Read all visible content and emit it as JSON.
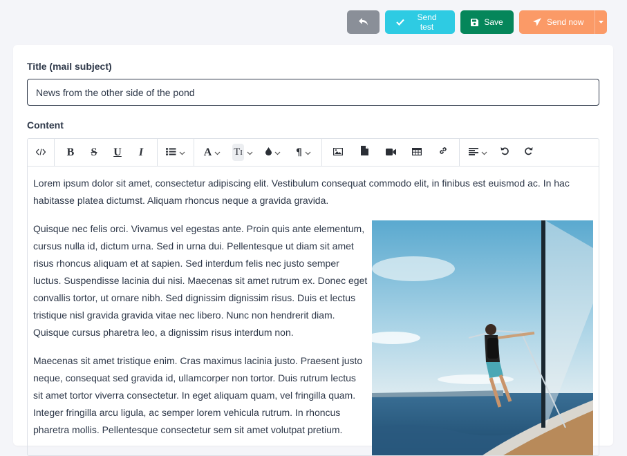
{
  "toolbar_actions": {
    "back_icon": "reply-icon",
    "send_test_label": "Send test",
    "save_label": "Save",
    "send_now_label": "Send now"
  },
  "colors": {
    "back": "#8a8f98",
    "send_test": "#2ecbe3",
    "save": "#05865a",
    "send_now": "#fb9a67"
  },
  "form": {
    "title_label": "Title (mail subject)",
    "title_value": "News from the other side of the pond",
    "content_label": "Content"
  },
  "editor": {
    "toolbar_groups": [
      [
        "code-view-icon"
      ],
      [
        "bold-icon",
        "strikethrough-icon",
        "underline-icon",
        "italic-icon"
      ],
      [
        "list-icon"
      ],
      [
        "font-color-icon",
        "text-size-icon",
        "highlight-icon",
        "paragraph-icon"
      ],
      [
        "image-icon",
        "file-icon",
        "video-icon",
        "table-icon",
        "link-icon"
      ],
      [
        "align-icon",
        "undo-icon",
        "redo-icon"
      ]
    ],
    "paragraphs": [
      "Lorem ipsum dolor sit amet, consectetur adipiscing elit. Vestibulum consequat commodo elit, in finibus est euismod ac. In hac habitasse platea dictumst. Aliquam rhoncus neque a gravida gravida.",
      "Quisque nec felis orci. Vivamus vel egestas ante. Proin quis ante elementum, cursus nulla id, dictum urna. Sed in urna dui. Pellentesque ut diam sit amet risus rhoncus aliquam et at sapien. Sed interdum felis nec justo semper luctus. Suspendisse lacinia dui nisi. Maecenas sit amet rutrum ex. Donec eget convallis tortor, ut ornare nibh. Sed dignissim dignissim risus. Duis et lectus tristique nisl gravida gravida vitae nec libero. Nunc non hendrerit diam. Quisque cursus pharetra leo, a dignissim risus interdum non.",
      "Maecenas sit amet tristique enim. Cras maximus lacinia justo. Praesent justo neque, consequat sed gravida id, ullamcorper non tortor. Duis rutrum lectus sit amet tortor viverra consectetur. In eget aliquam quam, vel fringilla quam. Integer fringilla arcu ligula, ac semper lorem vehicula rutrum. In rhoncus pharetra mollis. Pellentesque consectetur sem sit amet volutpat pretium."
    ]
  }
}
